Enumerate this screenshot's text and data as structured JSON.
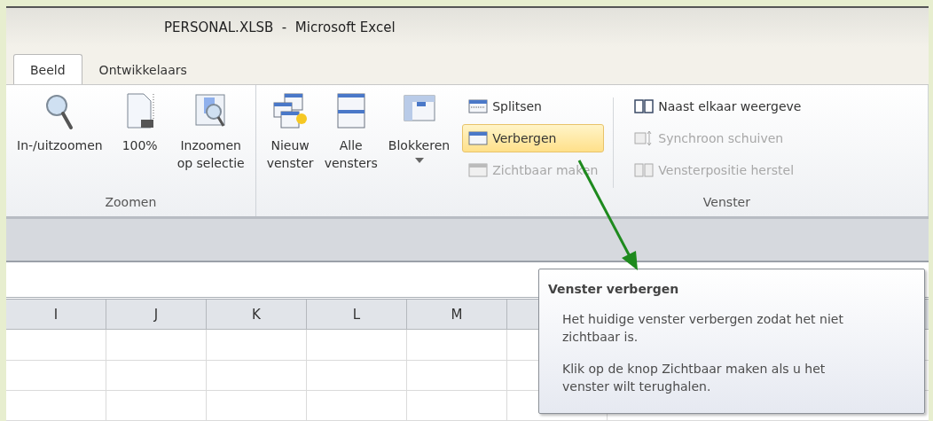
{
  "window": {
    "title": "PERSONAL.XLSB  -  Microsoft Excel"
  },
  "tabs": [
    {
      "label": "Beeld",
      "selected": true
    },
    {
      "label": "Ontwikkelaars",
      "selected": false
    }
  ],
  "ribbon": {
    "groups": [
      {
        "label": "Zoomen",
        "items": [
          {
            "kind": "large",
            "lines": [
              "In-/uitzoomen"
            ]
          },
          {
            "kind": "large",
            "lines": [
              "100%"
            ]
          },
          {
            "kind": "large",
            "lines": [
              "Inzoomen",
              "op selectie"
            ]
          }
        ]
      },
      {
        "label": "Venster",
        "items": [
          {
            "kind": "large",
            "lines": [
              "Nieuw",
              "venster"
            ]
          },
          {
            "kind": "large",
            "lines": [
              "Alle",
              "vensters"
            ]
          },
          {
            "kind": "large",
            "lines": [
              "Blokkeren"
            ],
            "dropdown": true
          },
          {
            "kind": "small",
            "label": "Splitsen",
            "disabled": false,
            "hovered": false
          },
          {
            "kind": "small",
            "label": "Verbergen",
            "disabled": false,
            "hovered": true
          },
          {
            "kind": "small",
            "label": "Zichtbaar maken",
            "disabled": true,
            "hovered": false
          },
          {
            "kind": "separator"
          },
          {
            "kind": "small",
            "label": "Naast elkaar weergeve",
            "disabled": false,
            "hovered": false
          },
          {
            "kind": "small",
            "label": "Synchroon schuiven",
            "disabled": true,
            "hovered": false
          },
          {
            "kind": "small",
            "label": "Vensterpositie herstel",
            "disabled": true,
            "hovered": false
          }
        ]
      }
    ]
  },
  "sheet": {
    "columns": [
      "I",
      "J",
      "K",
      "L",
      "M"
    ]
  },
  "tooltip": {
    "title": "Venster verbergen",
    "paragraphs": [
      "Het huidige venster verbergen zodat het niet zichtbaar is.",
      "Klik op de knop Zichtbaar maken als u het venster wilt terughalen."
    ]
  }
}
